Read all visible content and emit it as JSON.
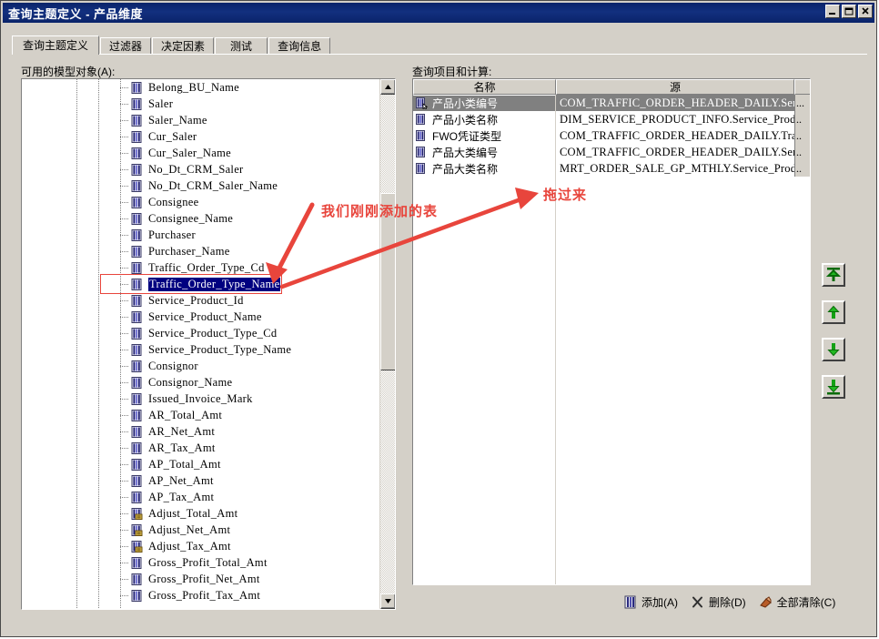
{
  "window": {
    "title": "查询主题定义 - 产品维度",
    "buttons": {
      "minimize": "minimize",
      "maximize": "maximize",
      "close": "close"
    }
  },
  "tabs": [
    {
      "label": "查询主题定义",
      "active": true
    },
    {
      "label": "过滤器",
      "active": false
    },
    {
      "label": "决定因素",
      "active": false
    },
    {
      "label": "测试",
      "active": false
    },
    {
      "label": "查询信息",
      "active": false
    }
  ],
  "left_panel": {
    "label": "可用的模型对象(A):",
    "items": [
      {
        "label": "Belong_BU_Name",
        "icon": "column-icon",
        "selected": false
      },
      {
        "label": "Saler",
        "icon": "column-icon",
        "selected": false
      },
      {
        "label": "Saler_Name",
        "icon": "column-icon",
        "selected": false
      },
      {
        "label": "Cur_Saler",
        "icon": "column-icon",
        "selected": false
      },
      {
        "label": "Cur_Saler_Name",
        "icon": "column-icon",
        "selected": false
      },
      {
        "label": "No_Dt_CRM_Saler",
        "icon": "column-icon",
        "selected": false
      },
      {
        "label": "No_Dt_CRM_Saler_Name",
        "icon": "column-icon",
        "selected": false
      },
      {
        "label": "Consignee",
        "icon": "column-icon",
        "selected": false
      },
      {
        "label": "Consignee_Name",
        "icon": "column-icon",
        "selected": false
      },
      {
        "label": "Purchaser",
        "icon": "column-icon",
        "selected": false
      },
      {
        "label": "Purchaser_Name",
        "icon": "column-icon",
        "selected": false
      },
      {
        "label": "Traffic_Order_Type_Cd",
        "icon": "column-icon",
        "selected": false
      },
      {
        "label": "Traffic_Order_Type_Name",
        "icon": "column-icon",
        "selected": true
      },
      {
        "label": "Service_Product_Id",
        "icon": "column-icon",
        "selected": false
      },
      {
        "label": "Service_Product_Name",
        "icon": "column-icon",
        "selected": false
      },
      {
        "label": "Service_Product_Type_Cd",
        "icon": "column-icon",
        "selected": false
      },
      {
        "label": "Service_Product_Type_Name",
        "icon": "column-icon",
        "selected": false
      },
      {
        "label": "Consignor",
        "icon": "column-icon",
        "selected": false
      },
      {
        "label": "Consignor_Name",
        "icon": "column-icon",
        "selected": false
      },
      {
        "label": "Issued_Invoice_Mark",
        "icon": "column-icon",
        "selected": false
      },
      {
        "label": "AR_Total_Amt",
        "icon": "column-icon",
        "selected": false
      },
      {
        "label": "AR_Net_Amt",
        "icon": "column-icon",
        "selected": false
      },
      {
        "label": "AR_Tax_Amt",
        "icon": "column-icon",
        "selected": false
      },
      {
        "label": "AP_Total_Amt",
        "icon": "column-icon",
        "selected": false
      },
      {
        "label": "AP_Net_Amt",
        "icon": "column-icon",
        "selected": false
      },
      {
        "label": "AP_Tax_Amt",
        "icon": "column-icon",
        "selected": false
      },
      {
        "label": "Adjust_Total_Amt",
        "icon": "calculated-column-icon",
        "selected": false
      },
      {
        "label": "Adjust_Net_Amt",
        "icon": "calculated-column-icon",
        "selected": false
      },
      {
        "label": "Adjust_Tax_Amt",
        "icon": "calculated-column-icon",
        "selected": false
      },
      {
        "label": "Gross_Profit_Total_Amt",
        "icon": "column-icon",
        "selected": false
      },
      {
        "label": "Gross_Profit_Net_Amt",
        "icon": "column-icon",
        "selected": false
      },
      {
        "label": "Gross_Profit_Tax_Amt",
        "icon": "column-icon",
        "selected": false
      }
    ],
    "scrollbar": {
      "up_arrow": "scroll-up-icon",
      "down_arrow": "scroll-down-icon"
    }
  },
  "right_panel": {
    "label": "查询项目和计算:",
    "columns": [
      {
        "key": "name",
        "header": "名称"
      },
      {
        "key": "source",
        "header": "源"
      }
    ],
    "rows": [
      {
        "name": "产品小类编号",
        "source": "COM_TRAFFIC_ORDER_HEADER_DAILY.Service_Produ",
        "truncation": "...",
        "icon": "query-item-drag-icon",
        "selected": true
      },
      {
        "name": "产品小类名称",
        "source": "DIM_SERVICE_PRODUCT_INFO.Service_Product_Nam",
        "truncation": "..",
        "icon": "query-item-icon",
        "selected": false
      },
      {
        "name": "FWO凭证类型",
        "source": "COM_TRAFFIC_ORDER_HEADER_DAILY.Traffic_Order",
        "truncation": "..",
        "icon": "query-item-icon",
        "selected": false
      },
      {
        "name": "产品大类编号",
        "source": "COM_TRAFFIC_ORDER_HEADER_DAILY.Service_Produ",
        "truncation": "..",
        "icon": "query-item-icon",
        "selected": false
      },
      {
        "name": "产品大类名称",
        "source": "MRT_ORDER_SALE_GP_MTHLY.Service_Product_Type",
        "truncation": "..",
        "icon": "query-item-icon",
        "selected": false
      }
    ]
  },
  "order_buttons": [
    {
      "name": "move-to-top-button",
      "icon": "arrow-to-top-icon"
    },
    {
      "name": "move-up-button",
      "icon": "arrow-up-icon"
    },
    {
      "name": "move-down-button",
      "icon": "arrow-down-icon"
    },
    {
      "name": "move-to-bottom-button",
      "icon": "arrow-to-bottom-icon"
    }
  ],
  "bottom_buttons": [
    {
      "label": "添加(A)",
      "icon": "add-column-icon"
    },
    {
      "label": "删除(D)",
      "icon": "delete-x-icon"
    },
    {
      "label": "全部清除(C)",
      "icon": "clear-all-eraser-icon"
    }
  ],
  "annotations": {
    "color": "#e8453c",
    "note_left": "我们刚刚添加的表",
    "note_right": "拖过来"
  }
}
